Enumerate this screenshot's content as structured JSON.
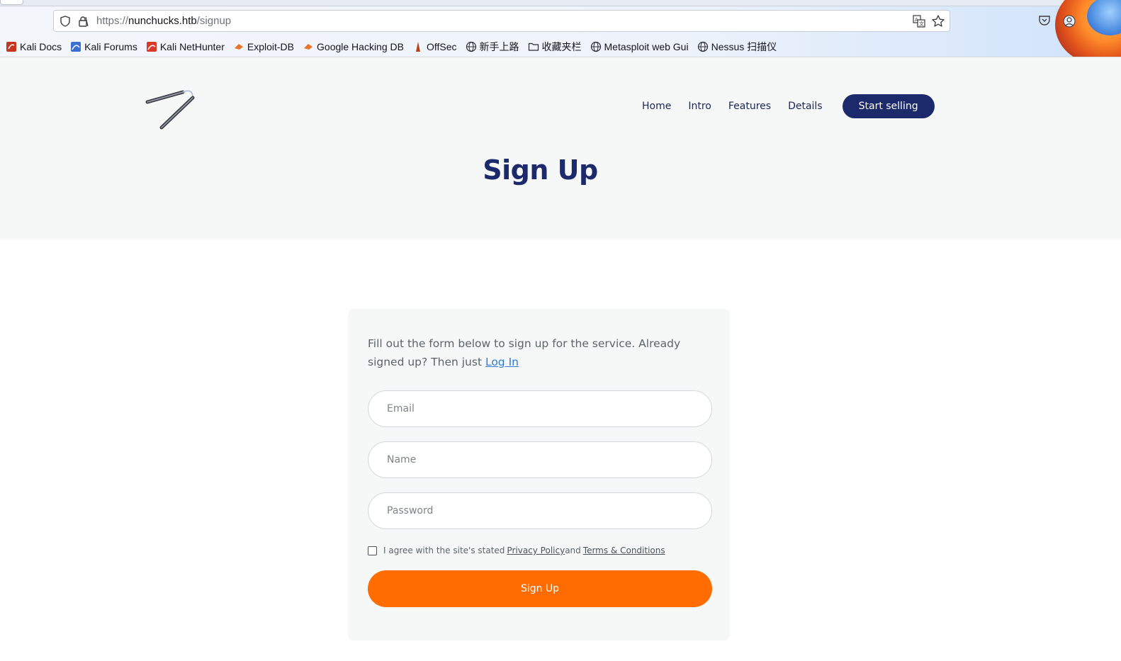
{
  "browser": {
    "url_prefix": "https://",
    "url_host": "nunchucks.htb",
    "url_path": "/signup",
    "bookmarks": [
      {
        "label": "Kali Docs",
        "icon": "kali-docs-icon"
      },
      {
        "label": "Kali Forums",
        "icon": "kali-forums-icon"
      },
      {
        "label": "Kali NetHunter",
        "icon": "kali-nethunter-icon"
      },
      {
        "label": "Exploit-DB",
        "icon": "exploit-db-icon"
      },
      {
        "label": "Google Hacking DB",
        "icon": "ghdb-icon"
      },
      {
        "label": "OffSec",
        "icon": "offsec-icon"
      },
      {
        "label": "新手上路",
        "icon": "globe-icon"
      },
      {
        "label": "收藏夹栏",
        "icon": "folder-icon"
      },
      {
        "label": "Metasploit web Gui",
        "icon": "globe-icon"
      },
      {
        "label": "Nessus 扫描仪",
        "icon": "globe-icon"
      }
    ]
  },
  "nav": {
    "items": [
      "Home",
      "Intro",
      "Features",
      "Details"
    ],
    "cta": "Start selling"
  },
  "page": {
    "title": "Sign Up"
  },
  "form": {
    "intro_text": "Fill out the form below to sign up for the service. Already signed up? Then just ",
    "login_link": "Log In",
    "email_placeholder": "Email",
    "name_placeholder": "Name",
    "password_placeholder": "Password",
    "agree_text": "I agree with the site's stated",
    "privacy_link": "Privacy Policy",
    "and_text": "and",
    "terms_link": "Terms & Conditions",
    "submit_label": "Sign Up"
  },
  "colors": {
    "brand_navy": "#1c2a6b",
    "accent_orange": "#ff6c02",
    "link_blue": "#2f7bd6"
  }
}
